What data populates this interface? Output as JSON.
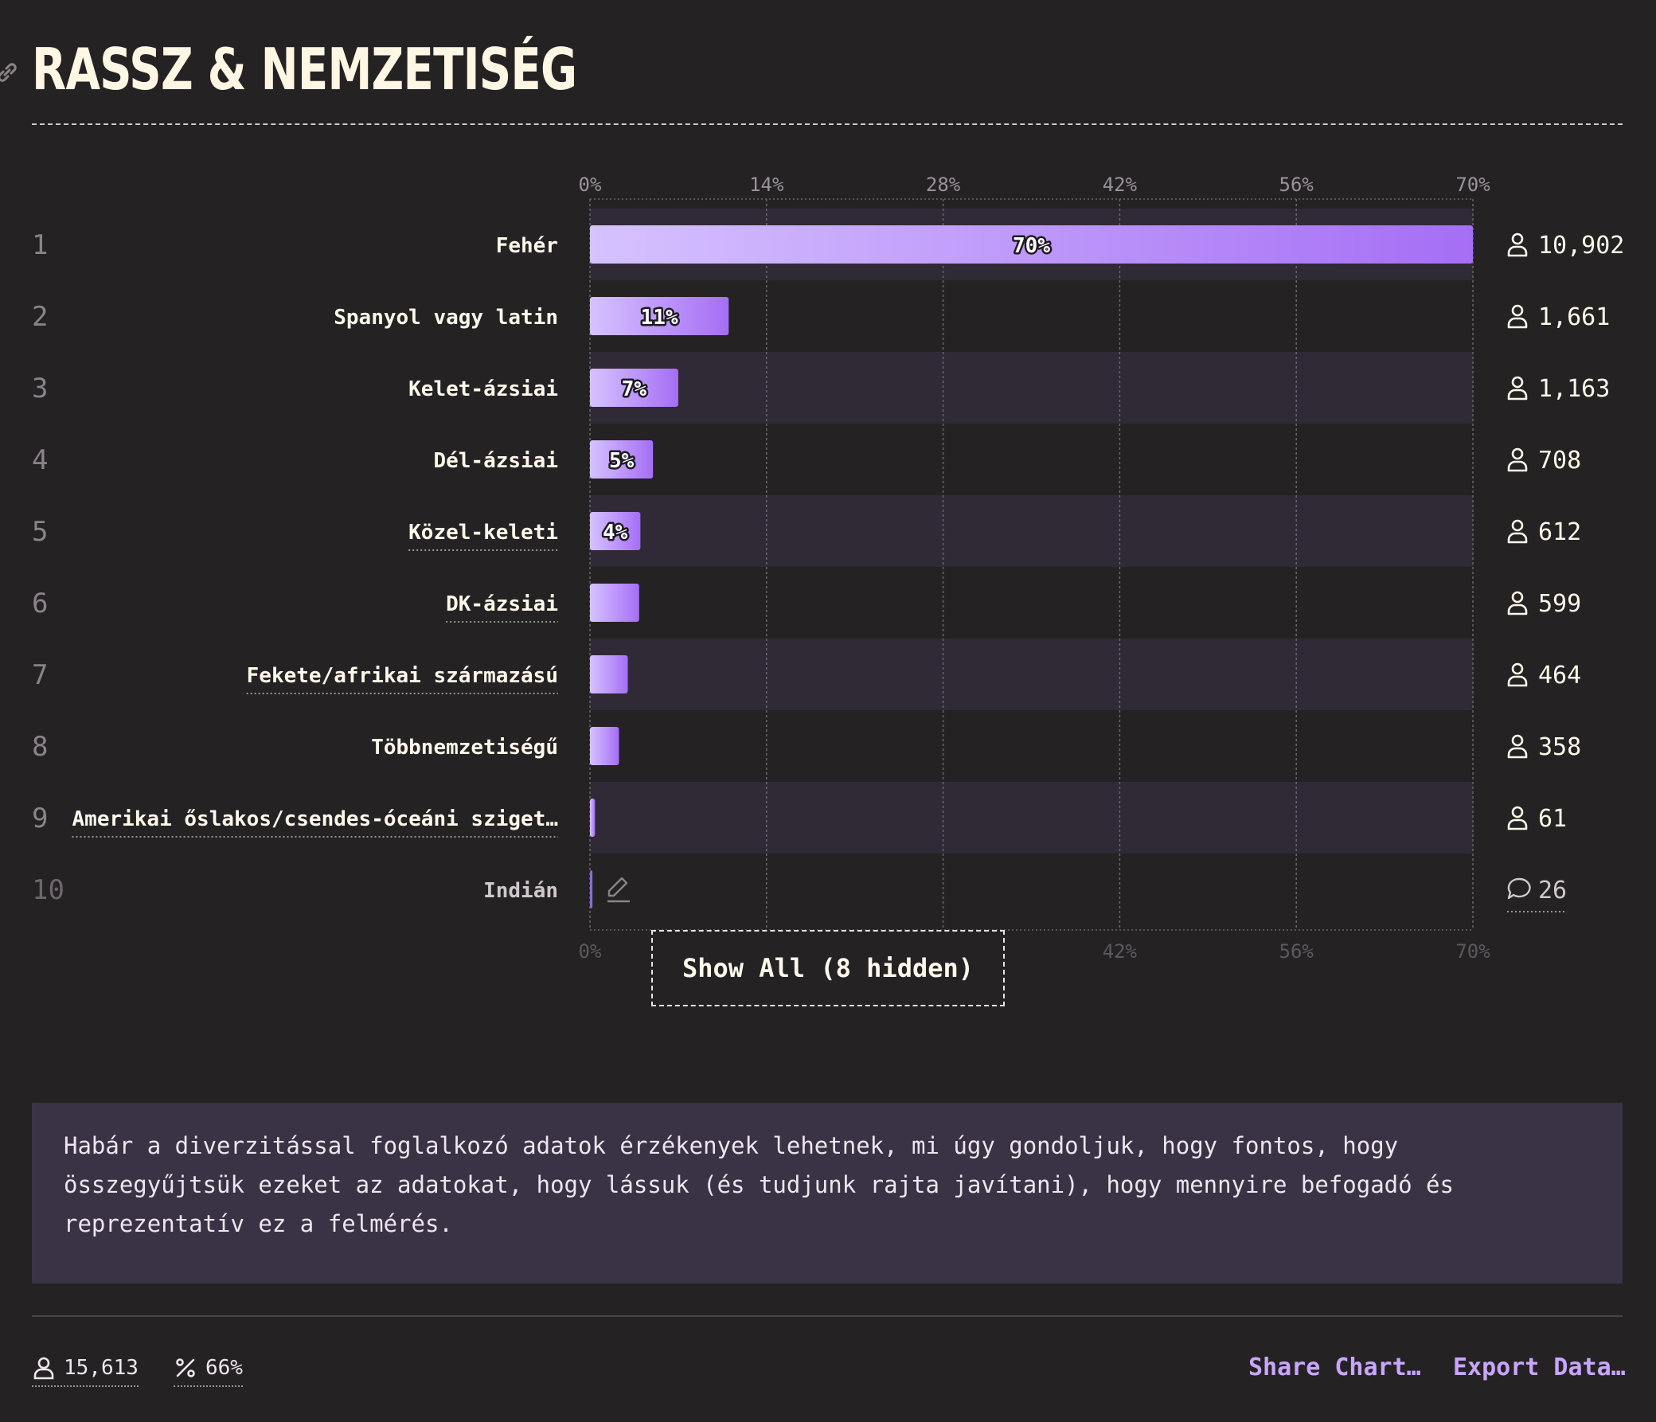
{
  "header": {
    "title": "RASSZ & NEMZETISÉG"
  },
  "chart_data": {
    "type": "bar",
    "orientation": "horizontal",
    "axis": {
      "ticks": [
        "0%",
        "14%",
        "28%",
        "42%",
        "56%",
        "70%"
      ],
      "range": [
        0,
        70
      ],
      "grid": true
    },
    "rows": [
      {
        "rank": "1",
        "label": "Fehér",
        "pct": 70,
        "pct_label": "70%",
        "count": "10,902",
        "icon": "user-icon",
        "underline": false
      },
      {
        "rank": "2",
        "label": "Spanyol vagy latin",
        "pct": 11,
        "pct_label": "11%",
        "count": "1,661",
        "icon": "user-icon",
        "underline": false
      },
      {
        "rank": "3",
        "label": "Kelet-ázsiai",
        "pct": 7,
        "pct_label": "7%",
        "count": "1,163",
        "icon": "user-icon",
        "underline": false
      },
      {
        "rank": "4",
        "label": "Dél-ázsiai",
        "pct": 5,
        "pct_label": "5%",
        "count": "708",
        "icon": "user-icon",
        "underline": false
      },
      {
        "rank": "5",
        "label": "Közel-keleti",
        "pct": 4,
        "pct_label": "4%",
        "count": "612",
        "icon": "user-icon",
        "underline": true
      },
      {
        "rank": "6",
        "label": "DK-ázsiai",
        "pct": 3.9,
        "pct_label": "",
        "count": "599",
        "icon": "user-icon",
        "underline": true
      },
      {
        "rank": "7",
        "label": "Fekete/afrikai származású",
        "pct": 3,
        "pct_label": "",
        "count": "464",
        "icon": "user-icon",
        "underline": true
      },
      {
        "rank": "8",
        "label": "Többnemzetiségű",
        "pct": 2.3,
        "pct_label": "",
        "count": "358",
        "icon": "user-icon",
        "underline": false
      },
      {
        "rank": "9",
        "label": "Amerikai őslakos/csendes-óceáni sziget…",
        "pct": 0.4,
        "pct_label": "",
        "count": "61",
        "icon": "user-icon",
        "underline": true
      },
      {
        "rank": "10",
        "label": "Indián",
        "pct": 0.2,
        "pct_label": "",
        "count": "26",
        "icon": "comment-icon",
        "underline": false,
        "muted": true
      }
    ],
    "bar_gradient": [
      "#d6c2ff",
      "#a56ef5"
    ]
  },
  "controls": {
    "show_all_label": "Show All (8 hidden)"
  },
  "note": {
    "text": "Habár a diverzitással foglalkozó adatok érzékenyek lehetnek, mi úgy gondoljuk, hogy fontos, hogy összegyűjtsük ezeket az adatokat, hogy lássuk (és tudjunk rajta javítani), hogy mennyire befogadó és reprezentatív ez a felmérés."
  },
  "footer": {
    "respondents": "15,613",
    "percentage": "66%",
    "share_label": "Share Chart…",
    "export_label": "Export Data…"
  }
}
